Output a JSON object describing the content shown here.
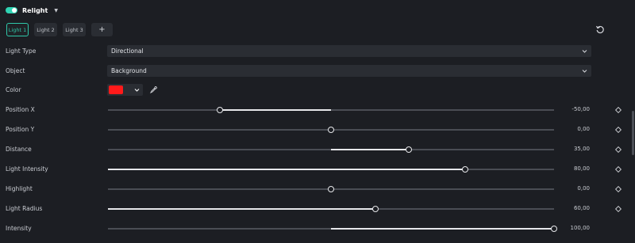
{
  "header": {
    "title": "Relight",
    "toggle_on": true
  },
  "tabs": [
    {
      "label": "Light 1",
      "active": true
    },
    {
      "label": "Light 2",
      "active": false
    },
    {
      "label": "Light 3",
      "active": false
    }
  ],
  "add_tab_label": "+",
  "dropdowns": {
    "light_type": {
      "label": "Light Type",
      "value": "Directional"
    },
    "object": {
      "label": "Object",
      "value": "Background"
    }
  },
  "color": {
    "label": "Color",
    "value": "#ff1a1a"
  },
  "sliders": [
    {
      "key": "position_x",
      "label": "Position X",
      "value": -50,
      "display": "-50,00",
      "min": -100,
      "max": 100,
      "bipolar": true
    },
    {
      "key": "position_y",
      "label": "Position Y",
      "value": 0,
      "display": "0,00",
      "min": -100,
      "max": 100,
      "bipolar": true
    },
    {
      "key": "distance",
      "label": "Distance",
      "value": 35,
      "display": "35,00",
      "min": -100,
      "max": 100,
      "bipolar": true
    },
    {
      "key": "light_intensity",
      "label": "Light Intensity",
      "value": 80,
      "display": "80,00",
      "min": 0,
      "max": 100,
      "bipolar": false
    },
    {
      "key": "highlight",
      "label": "Highlight",
      "value": 0,
      "display": "0,00",
      "min": -100,
      "max": 100,
      "bipolar": true
    },
    {
      "key": "light_radius",
      "label": "Light Radius",
      "value": 60,
      "display": "60,00",
      "min": 0,
      "max": 100,
      "bipolar": false
    },
    {
      "key": "intensity",
      "label": "Intensity",
      "value": 100,
      "display": "100,00",
      "min": -100,
      "max": 100,
      "bipolar": true
    }
  ],
  "colors": {
    "accent": "#2fd3b3",
    "background": "#1c1e23",
    "swatch": "#ff1a1a"
  }
}
